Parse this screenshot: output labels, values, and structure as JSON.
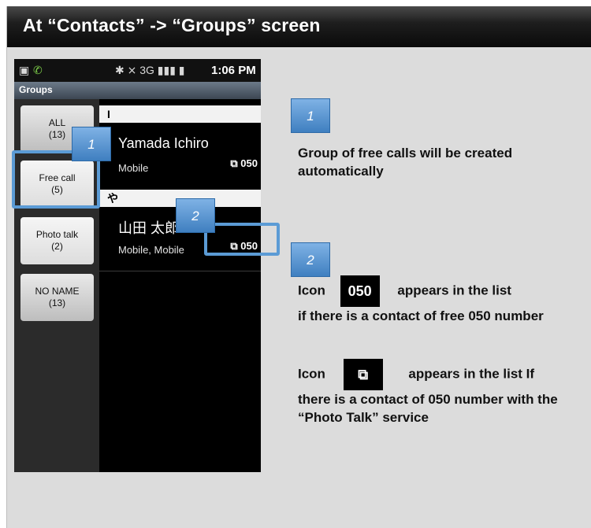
{
  "title": "At “Contacts” -> “Groups” screen",
  "statusbar": {
    "left_icons": [
      "briefcase-icon",
      "phone-ip-icon"
    ],
    "right_icons": "✱ ⨯ 3G ▮▮▮ ▮",
    "time": "1:06 PM"
  },
  "app_header": "Groups",
  "groups": [
    {
      "label": "ALL",
      "count": "(13)"
    },
    {
      "label": "Free call",
      "count": "(5)"
    },
    {
      "label": "Photo talk",
      "count": "(2)"
    },
    {
      "label": "NO NAME",
      "count": "(13)"
    }
  ],
  "sections": [
    {
      "header": "I",
      "contact": {
        "name": "Yamada Ichiro",
        "type": "Mobile",
        "icons": "⧉ 050"
      }
    },
    {
      "header": "や",
      "contact": {
        "name": "山田 太郎",
        "type": "Mobile, Mobile",
        "icons": "⧉ 050"
      }
    }
  ],
  "badges": {
    "one": "1",
    "two": "2"
  },
  "notes": {
    "note1": "Group of free calls will be  created automatically",
    "note2_icon_label": "Icon",
    "note2_line1": "appears in the list",
    "note2_rest": "if there is a contact of free 050 number",
    "note3_icon_label": "Icon",
    "note3_line1": "appears in the list If",
    "note3_rest": "there is a contact of 050 number with the “Photo Talk” service"
  },
  "icons": {
    "free_050": "050",
    "photo_talk": "⧉"
  },
  "colors": {
    "highlight": "#5b9bd5",
    "badge": "#4a8ad0",
    "title_bg": "#111111"
  }
}
